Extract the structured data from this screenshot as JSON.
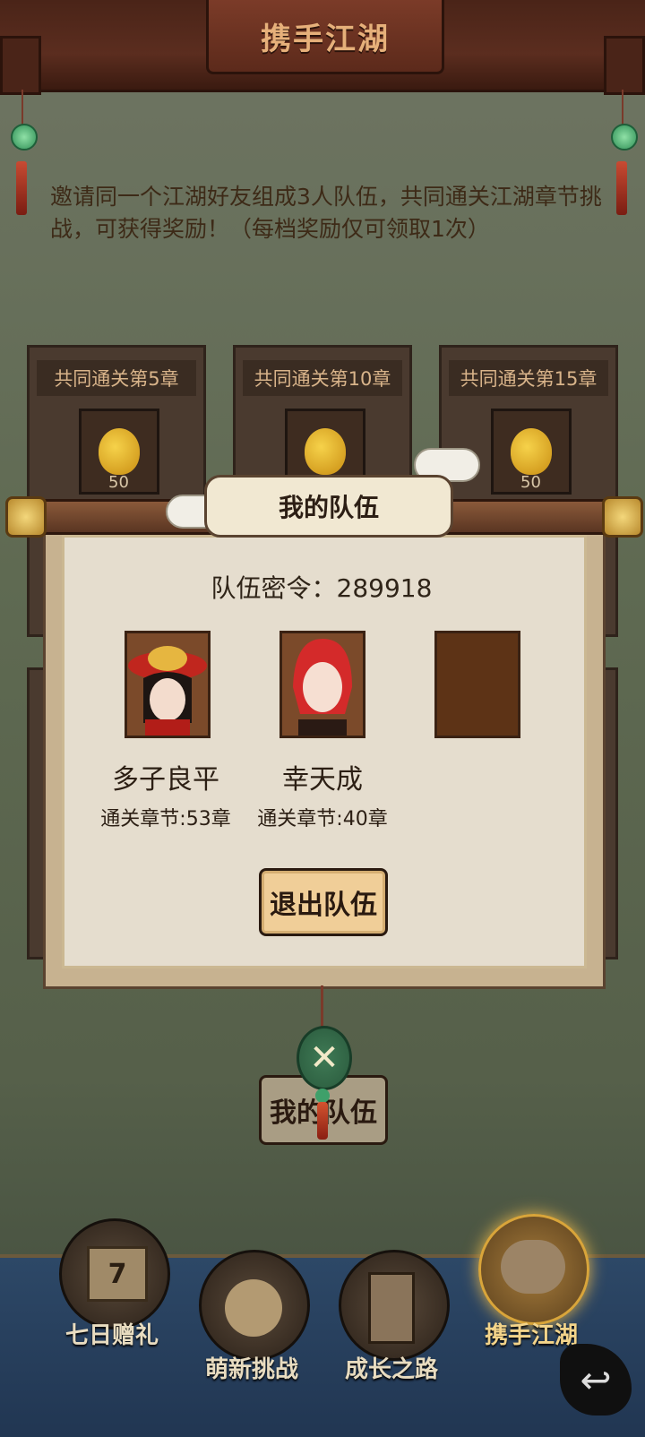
{
  "header": {
    "title": "携手江湖"
  },
  "intro": {
    "text": "邀请同一个江湖好友组成3人队伍，共同通关江湖章节挑战，可获得奖励！（每档奖励仅可领取1次）"
  },
  "rewards": [
    {
      "title": "共同通关第5章",
      "count": "50"
    },
    {
      "title": "共同通关第10章",
      "count": ""
    },
    {
      "title": "共同通关第15章",
      "count": "50"
    }
  ],
  "modal": {
    "title": "我的队伍",
    "code_label": "队伍密令：289918",
    "members": [
      {
        "name": "多子良平",
        "chapter": "通关章节:53章"
      },
      {
        "name": "幸天成",
        "chapter": "通关章节:40章"
      }
    ],
    "leave_button": "退出队伍"
  },
  "team_button": "我的队伍",
  "nav": [
    {
      "label": "七日赠礼",
      "badge": "7",
      "icon": "gift-box-icon"
    },
    {
      "label": "萌新挑战",
      "icon": "newbie-face-icon"
    },
    {
      "label": "成长之路",
      "icon": "book-arrow-icon"
    },
    {
      "label": "携手江湖",
      "icon": "handshake-icon"
    }
  ],
  "colors": {
    "header": "#5b2d1f",
    "modal_bg": "#e5ddce",
    "button": "#f0ce98",
    "nav_bg": "#213652"
  }
}
